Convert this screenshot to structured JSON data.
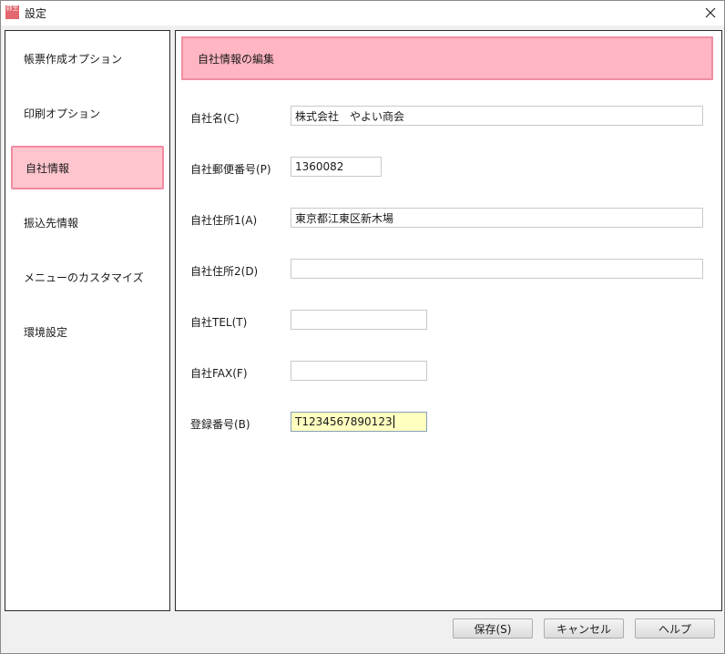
{
  "window": {
    "icon_text": "弥生",
    "title": "設定"
  },
  "sidebar": {
    "items": [
      {
        "label": "帳票作成オプション",
        "active": false
      },
      {
        "label": "印刷オプション",
        "active": false
      },
      {
        "label": "自社情報",
        "active": true
      },
      {
        "label": "振込先情報",
        "active": false
      },
      {
        "label": "メニューのカスタマイズ",
        "active": false
      },
      {
        "label": "環境設定",
        "active": false
      }
    ]
  },
  "content": {
    "header": "自社情報の編集",
    "fields": {
      "company_name": {
        "label": "自社名(C)",
        "value": "株式会社　やよい商会"
      },
      "postal_code": {
        "label": "自社郵便番号(P)",
        "value": "1360082"
      },
      "address1": {
        "label": "自社住所1(A)",
        "value": "東京都江東区新木場"
      },
      "address2": {
        "label": "自社住所2(D)",
        "value": ""
      },
      "tel": {
        "label": "自社TEL(T)",
        "value": ""
      },
      "fax": {
        "label": "自社FAX(F)",
        "value": ""
      },
      "registration_number": {
        "label": "登録番号(B)",
        "value": "T1234567890123"
      }
    }
  },
  "footer": {
    "save_label": "保存(S)",
    "cancel_label": "キャンセル",
    "help_label": "ヘルプ"
  },
  "colors": {
    "accent_pink": "#ffb5c2",
    "active_item": "#ffc5cf",
    "focused_input": "#ffffc0"
  }
}
